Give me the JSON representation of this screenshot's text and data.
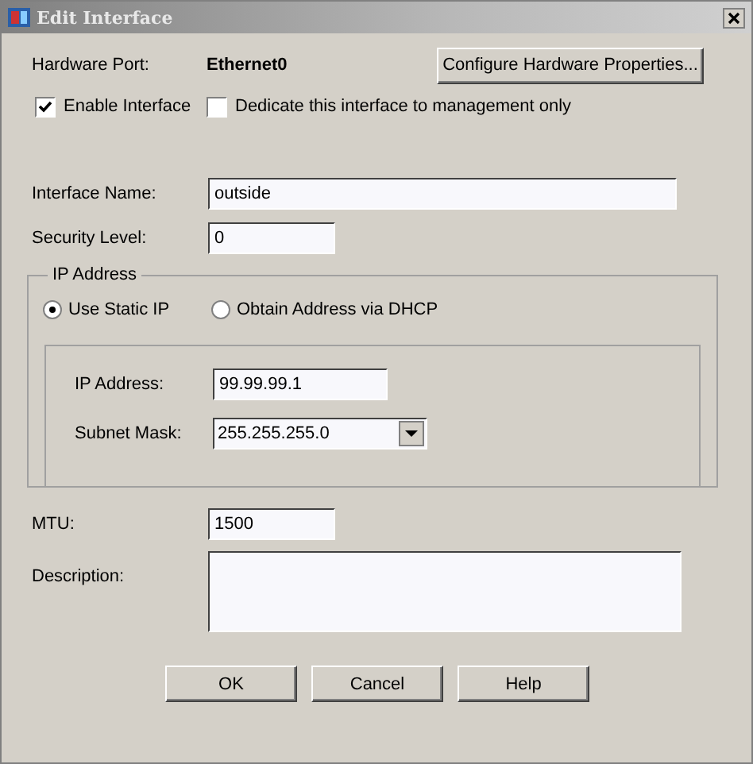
{
  "window": {
    "title": "Edit Interface"
  },
  "hardware_port": {
    "label": "Hardware Port:",
    "value": "Ethernet0"
  },
  "configure_button": "Configure Hardware Properties...",
  "checkboxes": [
    {
      "label": "Enable Interface",
      "checked": true
    },
    {
      "label": "Dedicate this interface to management only",
      "checked": false
    }
  ],
  "interface_name": {
    "label": "Interface Name:",
    "value": "outside"
  },
  "security_level": {
    "label": "Security Level:",
    "value": "0"
  },
  "ip_group": {
    "title": "IP Address",
    "options": [
      {
        "label": "Use Static IP",
        "selected": true
      },
      {
        "label": "Obtain Address via DHCP",
        "selected": false
      }
    ],
    "ip_address": {
      "label": "IP Address:",
      "value": "99.99.99.1"
    },
    "subnet_mask": {
      "label": "Subnet Mask:",
      "value": "255.255.255.0"
    }
  },
  "mtu": {
    "label": "MTU:",
    "value": "1500"
  },
  "description": {
    "label": "Description:"
  },
  "buttons": [
    "OK",
    "Cancel",
    "Help"
  ]
}
